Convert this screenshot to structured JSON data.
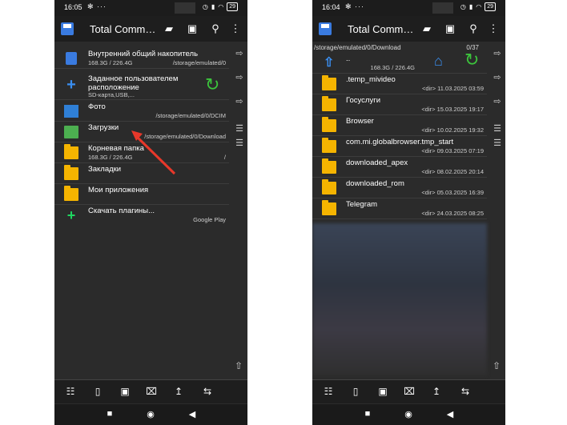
{
  "colors": {
    "accent_blue": "#3a7be0",
    "folder_yellow": "#f5b400",
    "refresh_green": "#3cc43c",
    "annotation_red": "#e8382a"
  },
  "left": {
    "status_time": "16:05",
    "battery": "29",
    "title": "Total Comm…",
    "items": [
      {
        "name": "Внутренний общий накопитель",
        "sub": "168.3G / 226.4G",
        "meta": "/storage/emulated/0",
        "icon": "sd-card-icon"
      },
      {
        "name": "Заданное пользователем расположение",
        "sub": "SD-карта,USB,...",
        "meta": "",
        "icon": "plus-icon"
      },
      {
        "name": "Фото",
        "sub": "",
        "meta": "/storage/emulated/0/DCIM",
        "icon": "photo-icon"
      },
      {
        "name": "Загрузки",
        "sub": "",
        "meta": "/storage/emulated/0/Download",
        "icon": "download-folder-icon"
      },
      {
        "name": "Корневая папка",
        "sub": "168.3G / 226.4G",
        "meta": "/",
        "icon": "folder-icon"
      },
      {
        "name": "Закладки",
        "sub": "",
        "meta": "",
        "icon": "bookmark-folder-icon"
      },
      {
        "name": "Мои приложения",
        "sub": "",
        "meta": "",
        "icon": "apps-folder-icon"
      },
      {
        "name": "Скачать плагины...",
        "sub": "",
        "meta": "Google Play",
        "icon": "green-plus-icon"
      }
    ]
  },
  "right": {
    "status_time": "16:04",
    "battery": "29",
    "title": "Total Comm…",
    "path": "/storage/emulated/0/Download",
    "count": "0/37",
    "up_row": {
      "name": "..",
      "meta": "168.3G / 226.4G"
    },
    "items": [
      {
        "name": ".temp_mivideo",
        "meta": "<dir>  11.03.2025  03:59"
      },
      {
        "name": "Госуслуги",
        "meta": "<dir>  15.03.2025  19:17"
      },
      {
        "name": "Browser",
        "meta": "<dir>  10.02.2025  19:32"
      },
      {
        "name": "com.mi.globalbrowser.tmp_start",
        "meta": "<dir>  09.03.2025  07:19"
      },
      {
        "name": "downloaded_apex",
        "meta": "<dir>  08.02.2025  20:14"
      },
      {
        "name": "downloaded_rom",
        "meta": "<dir>  05.03.2025  16:39"
      },
      {
        "name": "Telegram",
        "meta": "<dir>  24.03.2025  08:25"
      }
    ]
  }
}
